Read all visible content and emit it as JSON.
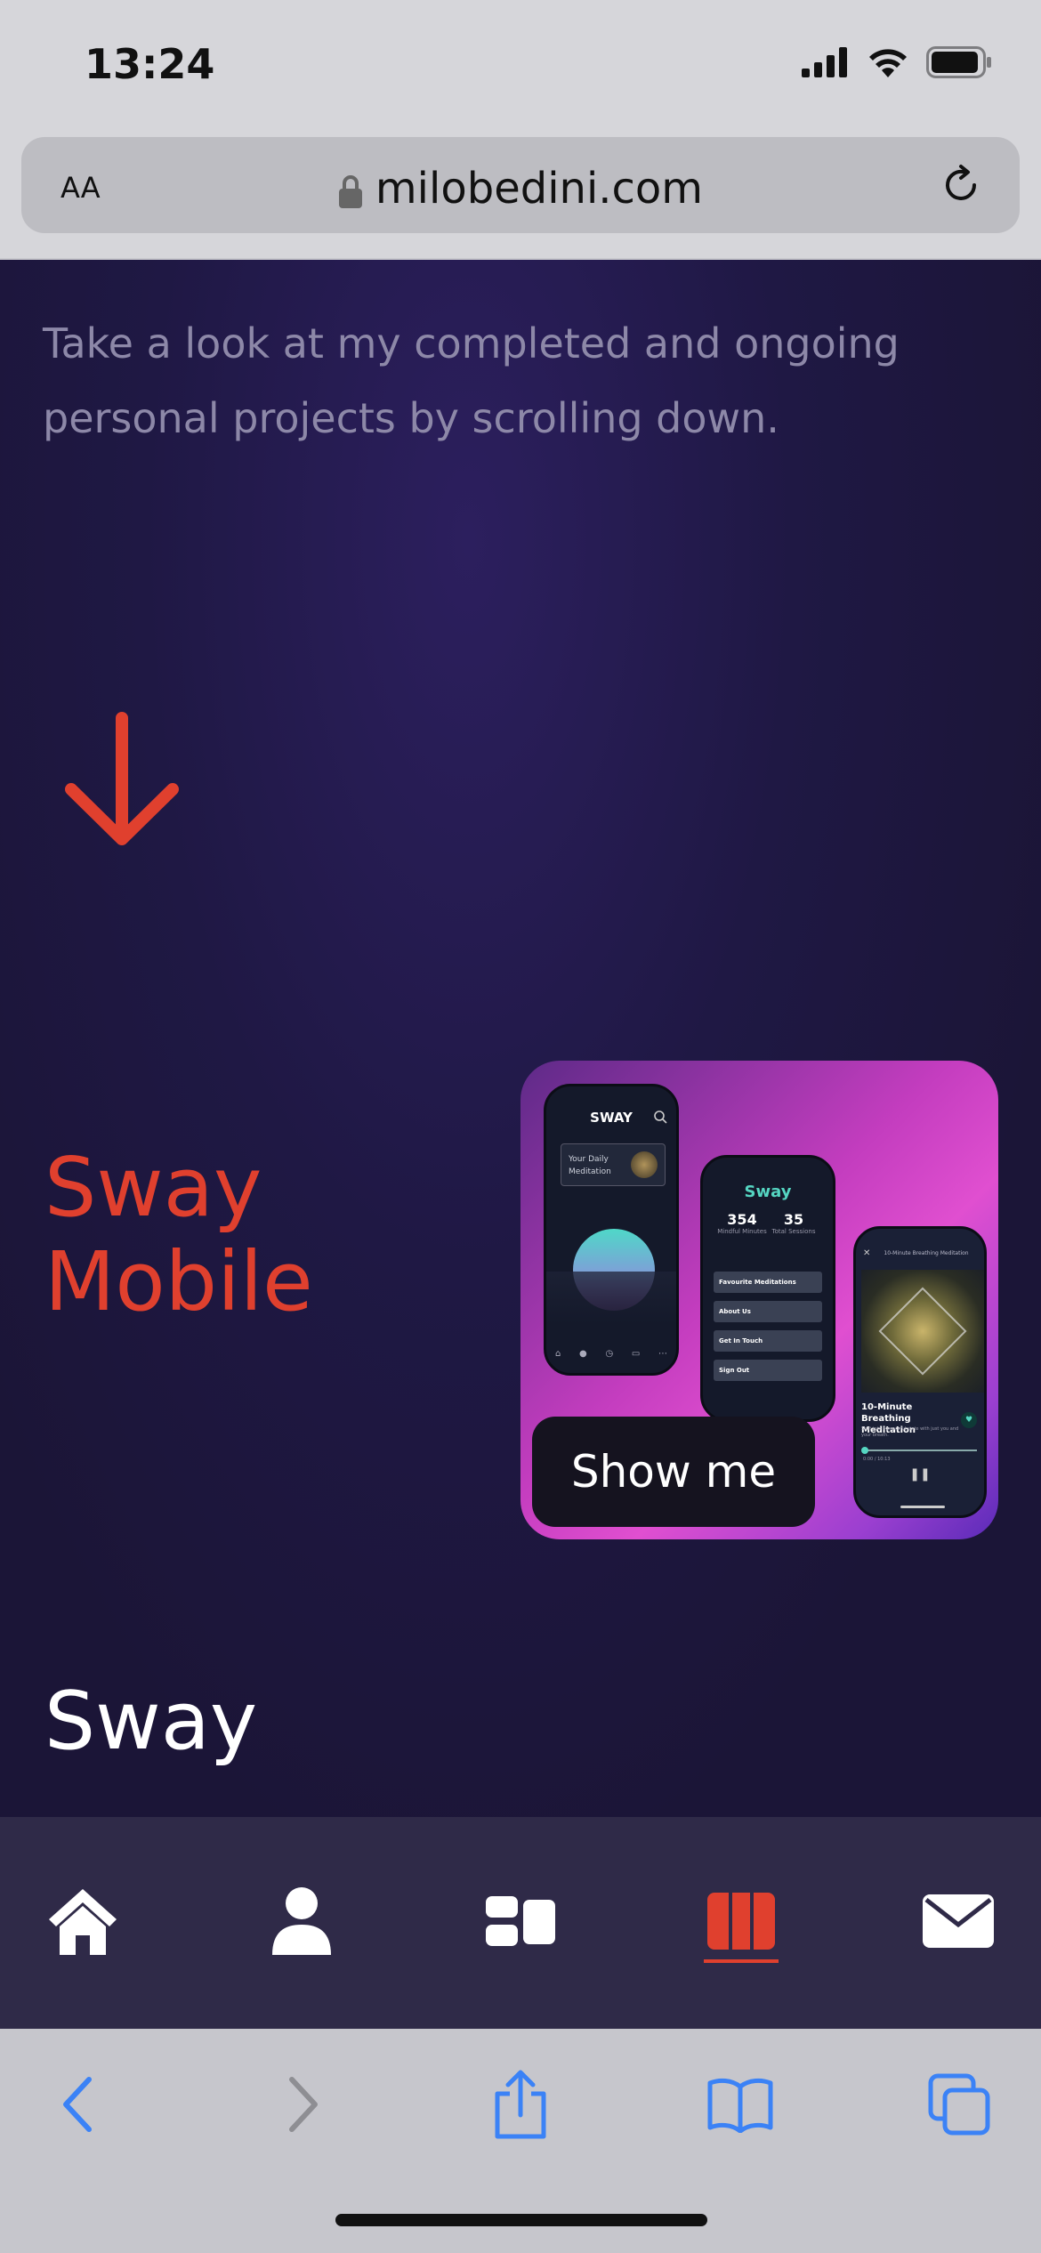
{
  "status": {
    "time": "13:24"
  },
  "browser": {
    "text_size_label": "AA",
    "domain": "milobedini.com"
  },
  "page": {
    "intro": "Take a look at my completed and ongoing personal projects by scrolling down.",
    "project_title_line1": "Sway",
    "project_title_line2": "Mobile",
    "show_button": "Show me",
    "section_title": "Sway"
  },
  "card": {
    "phone1": {
      "brand": "SWAY",
      "daily": "Your Daily Meditation"
    },
    "phone2": {
      "brand": "Sway",
      "stat1_value": "354",
      "stat1_label": "Mindful Minutes",
      "stat2_value": "35",
      "stat2_label": "Total Sessions",
      "menu": [
        "Favourite Meditations",
        "About Us",
        "Get In Touch",
        "Sign Out"
      ]
    },
    "phone3": {
      "header": "10-Minute Breathing Meditation",
      "title": "10-Minute Breathing Meditation",
      "desc": "Shift into a peaceful state with just you and your breath.",
      "time": "0:00 / 10:13"
    }
  },
  "nav": {
    "items": [
      "home-icon",
      "user-icon",
      "grid-icon",
      "projects-icon",
      "mail-icon"
    ],
    "active": "projects-icon",
    "accent": "#e0402e"
  },
  "toolbar": {
    "icons": [
      "back-icon",
      "forward-icon",
      "share-icon",
      "bookmarks-icon",
      "tabs-icon"
    ],
    "color": "#3b82f6"
  }
}
